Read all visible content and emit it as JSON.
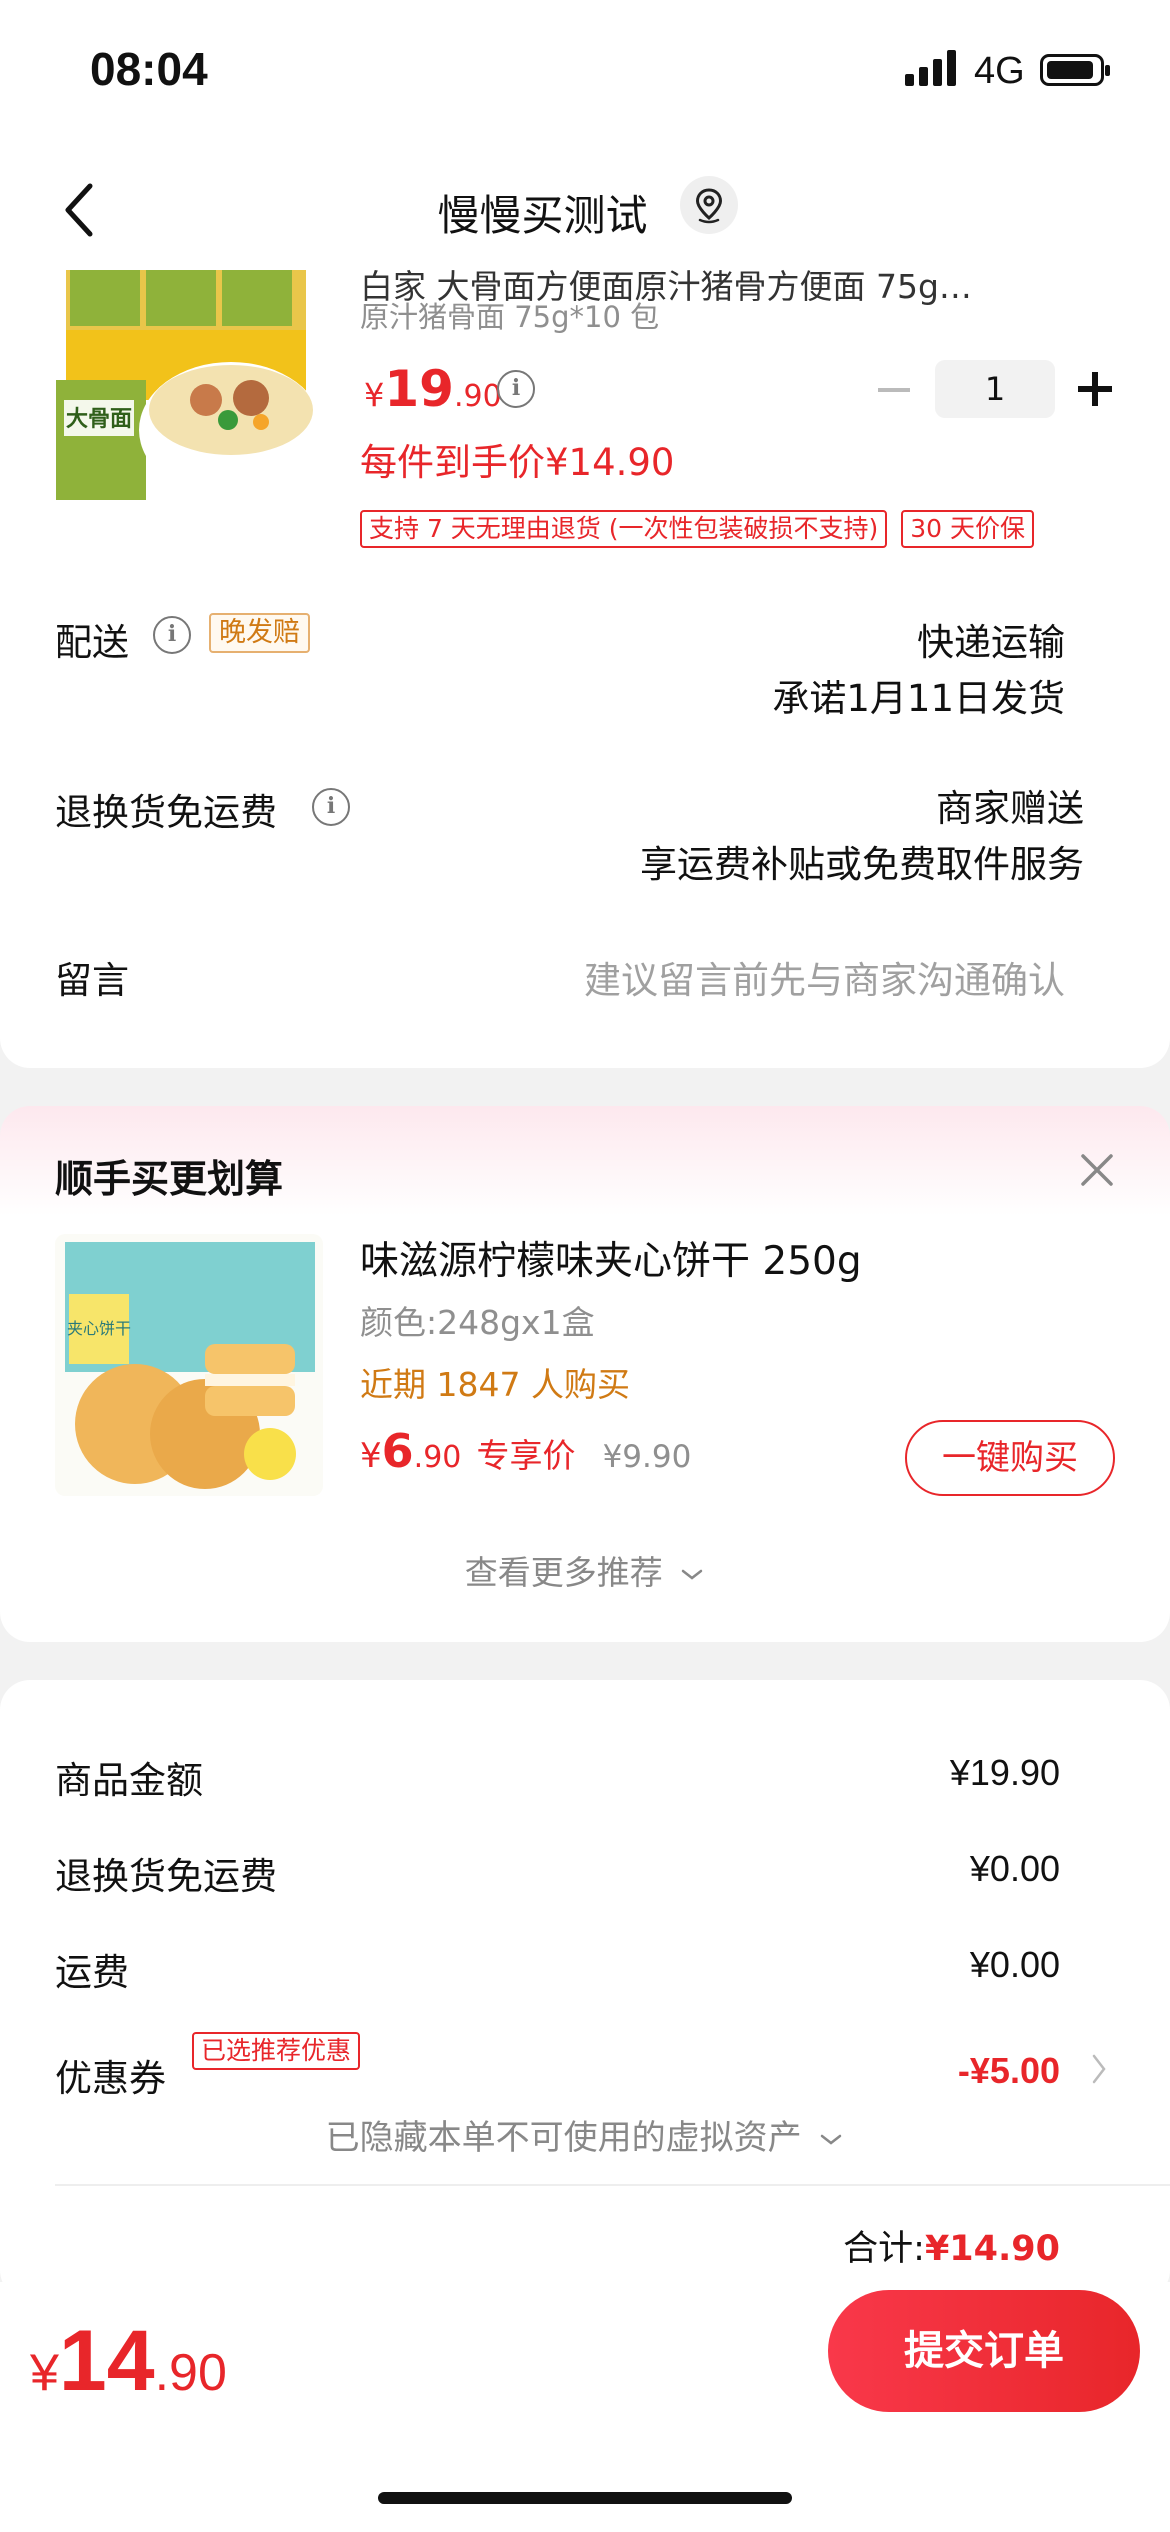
{
  "status_bar": {
    "time": "08:04",
    "network": "4G"
  },
  "nav": {
    "title": "慢慢买测试"
  },
  "product": {
    "name": "白家 大骨面方便面原汁猪骨方便面 75g…",
    "spec": "原汁猪骨面 75g*10 包",
    "price_currency": "¥",
    "price_int": "19",
    "price_dec": ".90",
    "quantity": "1",
    "hand_price": "每件到手价¥14.90",
    "tags": [
      "支持 7 天无理由退货 (一次性包装破损不支持)",
      "30 天价保"
    ],
    "image_text": "大骨面"
  },
  "delivery": {
    "label": "配送",
    "tag": "晚发赔",
    "method": "快递运输",
    "promise": "承诺1月11日发货"
  },
  "return_freight": {
    "label": "退换货免运费",
    "value1": "商家赠送",
    "value2": "享运费补贴或免费取件服务"
  },
  "message": {
    "label": "留言",
    "placeholder": "建议留言前先与商家沟通确认"
  },
  "recommend": {
    "header": "顺手买更划算",
    "name": "味滋源柠檬味夹心饼干 250g",
    "spec": "颜色:248gx1盒",
    "sold": "近期 1847 人购买",
    "price_currency": "¥",
    "price_int": "6",
    "price_dec": ".90",
    "price_tag": "专享价",
    "original_price": "¥9.90",
    "buy_button": "一键购买",
    "more": "查看更多推荐",
    "image_text": "夹心饼干"
  },
  "summary": {
    "rows": [
      {
        "label": "商品金额",
        "value": "¥19.90"
      },
      {
        "label": "退换货免运费",
        "value": "¥0.00"
      },
      {
        "label": "运费",
        "value": "¥0.00"
      }
    ],
    "coupon": {
      "label": "优惠券",
      "tag": "已选推荐优惠",
      "value": "-¥5.00"
    },
    "hidden_assets": "已隐藏本单不可使用的虚拟资产",
    "total_label": "合计:",
    "total_value": "¥14.90"
  },
  "bottom_bar": {
    "currency": "¥",
    "price_int": "14",
    "price_dec": ".90",
    "submit": "提交订单"
  },
  "colors": {
    "accent": "#e8262a",
    "orange": "#d07a14",
    "background": "#f2f2f2"
  }
}
